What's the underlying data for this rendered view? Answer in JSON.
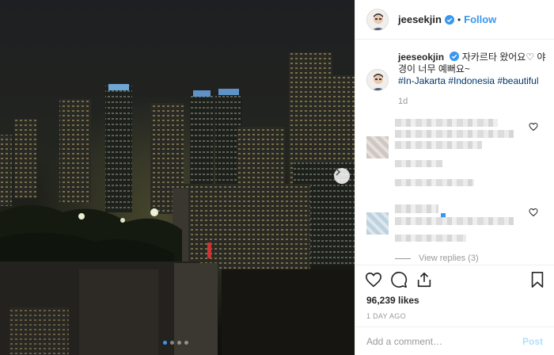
{
  "post": {
    "username": "jeesekjin",
    "follow_label": "Follow",
    "separator": "•",
    "caption": {
      "username": "jeeseokjin",
      "text": "자카르타 왔어요♡ 야경이 너무 예뻐요~",
      "hashtags": [
        "#In-Jakarta",
        "#Indonesia",
        "#beautiful"
      ]
    },
    "time_ago": "1d",
    "view_replies": "View replies (3)",
    "likes": "96,239 likes",
    "date": "1 DAY AGO",
    "comment_placeholder": "Add a comment…",
    "post_label": "Post"
  },
  "icons": {
    "verified": "verified-badge-icon",
    "heart": "heart-icon",
    "comment": "comment-icon",
    "share": "share-icon",
    "bookmark": "bookmark-icon",
    "next": "chevron-right-icon"
  },
  "colors": {
    "accent": "#3897f0",
    "hashtag": "#003569",
    "muted": "#999999"
  },
  "carousel": {
    "total": 4,
    "active": 1
  }
}
